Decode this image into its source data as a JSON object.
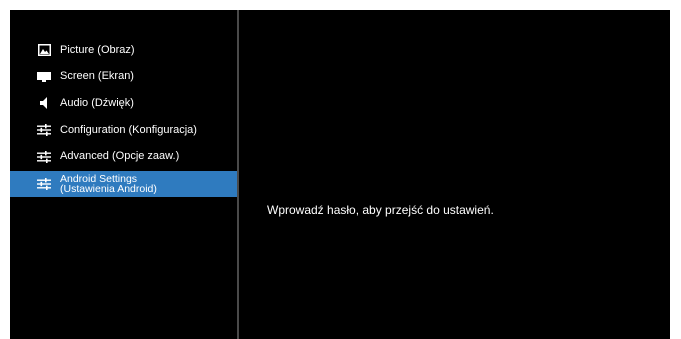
{
  "menu": {
    "items": [
      {
        "label": "Picture (Obraz)",
        "icon": "picture-icon"
      },
      {
        "label": "Screen (Ekran)",
        "icon": "screen-icon"
      },
      {
        "label": "Audio (Dźwięk)",
        "icon": "speaker-icon"
      },
      {
        "label": "Configuration (Konfiguracja)",
        "icon": "sliders-icon"
      },
      {
        "label": "Advanced (Opcje zaaw.)",
        "icon": "sliders-icon"
      },
      {
        "label_line1": "Android Settings",
        "label_line2": "(Ustawienia Android)",
        "icon": "sliders-icon",
        "selected": true
      }
    ]
  },
  "content": {
    "message": "Wprowadź hasło, aby przejść do ustawień."
  },
  "colors": {
    "background": "#000000",
    "selected": "#2f7bbf",
    "text": "#ffffff",
    "divider": "#4a4a4a"
  }
}
